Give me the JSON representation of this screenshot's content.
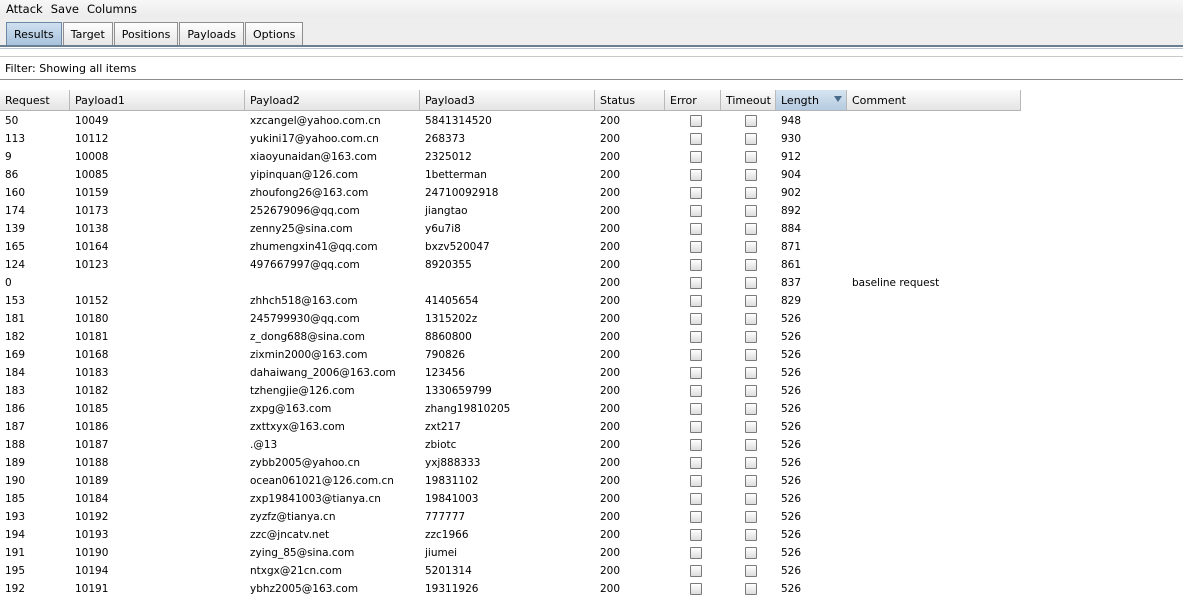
{
  "menu": [
    "Attack",
    "Save",
    "Columns"
  ],
  "tabs": [
    {
      "label": "Results",
      "active": true
    },
    {
      "label": "Target",
      "active": false
    },
    {
      "label": "Positions",
      "active": false
    },
    {
      "label": "Payloads",
      "active": false
    },
    {
      "label": "Options",
      "active": false
    }
  ],
  "filter": {
    "text": "Filter:  Showing all items"
  },
  "columns": [
    "Request",
    "Payload1",
    "Payload2",
    "Payload3",
    "Status",
    "Error",
    "Timeout",
    "Length",
    "Comment"
  ],
  "sorted_column": "Length",
  "rows": [
    [
      "50",
      "10049",
      "xzcangel@yahoo.com.cn",
      "5841314520",
      "200",
      "948",
      ""
    ],
    [
      "113",
      "10112",
      "yukini17@yahoo.com.cn",
      "268373",
      "200",
      "930",
      ""
    ],
    [
      "9",
      "10008",
      "xiaoyunaidan@163.com",
      "2325012",
      "200",
      "912",
      ""
    ],
    [
      "86",
      "10085",
      "yipinquan@126.com",
      "1betterman",
      "200",
      "904",
      ""
    ],
    [
      "160",
      "10159",
      "zhoufong26@163.com",
      "24710092918",
      "200",
      "902",
      ""
    ],
    [
      "174",
      "10173",
      "252679096@qq.com",
      "jiangtao",
      "200",
      "892",
      ""
    ],
    [
      "139",
      "10138",
      "zenny25@sina.com",
      "y6u7i8",
      "200",
      "884",
      ""
    ],
    [
      "165",
      "10164",
      "zhumengxin41@qq.com",
      "bxzv520047",
      "200",
      "871",
      ""
    ],
    [
      "124",
      "10123",
      "497667997@qq.com",
      "8920355",
      "200",
      "861",
      ""
    ],
    [
      "0",
      "",
      "",
      "",
      "200",
      "837",
      "baseline request"
    ],
    [
      "153",
      "10152",
      "zhhch518@163.com",
      "41405654",
      "200",
      "829",
      ""
    ],
    [
      "181",
      "10180",
      "245799930@qq.com",
      "1315202z",
      "200",
      "526",
      ""
    ],
    [
      "182",
      "10181",
      "z_dong688@sina.com",
      "8860800",
      "200",
      "526",
      ""
    ],
    [
      "169",
      "10168",
      "zixmin2000@163.com",
      "790826",
      "200",
      "526",
      ""
    ],
    [
      "184",
      "10183",
      "dahaiwang_2006@163.com",
      "123456",
      "200",
      "526",
      ""
    ],
    [
      "183",
      "10182",
      "tzhengjie@126.com",
      "1330659799",
      "200",
      "526",
      ""
    ],
    [
      "186",
      "10185",
      "zxpg@163.com",
      "zhang19810205",
      "200",
      "526",
      ""
    ],
    [
      "187",
      "10186",
      "zxttxyx@163.com",
      "zxt217",
      "200",
      "526",
      ""
    ],
    [
      "188",
      "10187",
      ".@13",
      "zbiotc",
      "200",
      "526",
      ""
    ],
    [
      "189",
      "10188",
      "zybb2005@yahoo.cn",
      "yxj888333",
      "200",
      "526",
      ""
    ],
    [
      "190",
      "10189",
      "ocean061021@126.com.cn",
      "19831102",
      "200",
      "526",
      ""
    ],
    [
      "185",
      "10184",
      "zxp19841003@tianya.cn",
      "19841003",
      "200",
      "526",
      ""
    ],
    [
      "193",
      "10192",
      "zyzfz@tianya.cn",
      "777777",
      "200",
      "526",
      ""
    ],
    [
      "194",
      "10193",
      "zzc@jncatv.net",
      "zzc1966",
      "200",
      "526",
      ""
    ],
    [
      "191",
      "10190",
      "zying_85@sina.com",
      "jiumei",
      "200",
      "526",
      ""
    ],
    [
      "195",
      "10194",
      "ntxgx@21cn.com",
      "5201314",
      "200",
      "526",
      ""
    ],
    [
      "192",
      "10191",
      "ybhz2005@163.com",
      "19311926",
      "200",
      "526",
      ""
    ]
  ]
}
